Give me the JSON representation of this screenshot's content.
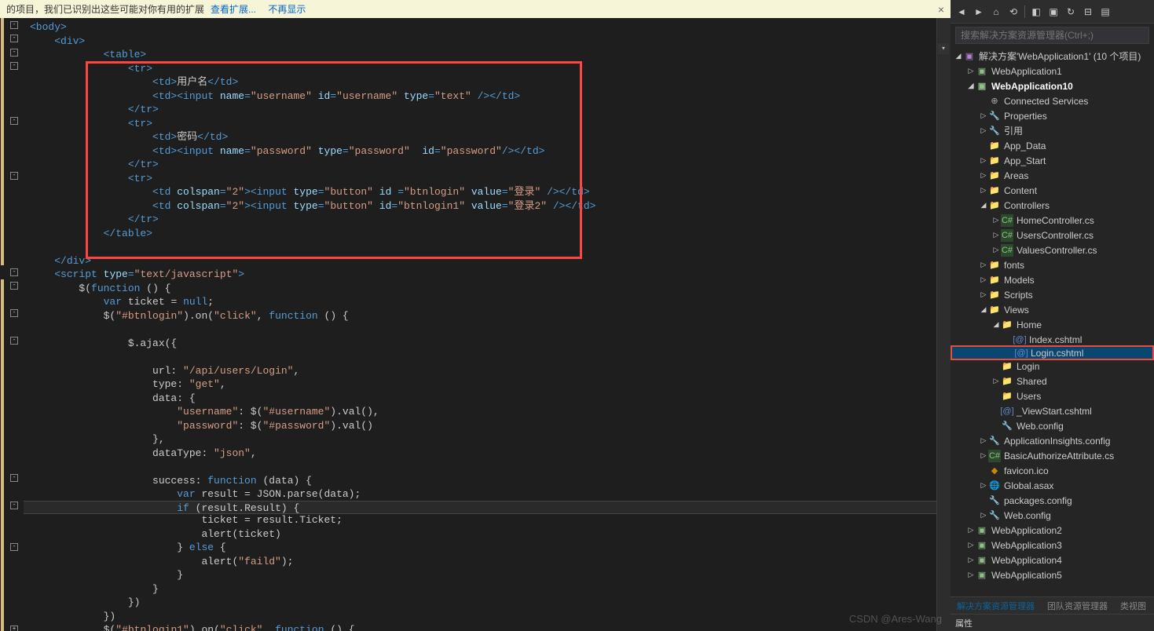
{
  "notification": {
    "text": "的项目，我们已识别出这些可能对你有用的扩展",
    "link1": "查看扩展...",
    "link2": "不再显示"
  },
  "code_lines": [
    {
      "indent": 0,
      "fold": "-",
      "html": "<span class='tag'>&lt;body&gt;</span>"
    },
    {
      "indent": 1,
      "fold": "-",
      "html": "<span class='tag'>&lt;div&gt;</span>"
    },
    {
      "indent": 3,
      "fold": "-",
      "html": "<span class='tag'>&lt;table&gt;</span>"
    },
    {
      "indent": 4,
      "fold": "-",
      "html": "<span class='tag'>&lt;tr&gt;</span>"
    },
    {
      "indent": 5,
      "fold": "",
      "html": "<span class='tag'>&lt;td&gt;</span><span class='txt'>用户名</span><span class='tag'>&lt;/td&gt;</span>"
    },
    {
      "indent": 5,
      "fold": "",
      "html": "<span class='tag'>&lt;td&gt;&lt;input</span> <span class='attr'>name</span><span class='tag'>=</span><span class='str'>\"username\"</span> <span class='attr'>id</span><span class='tag'>=</span><span class='str'>\"username\"</span> <span class='attr'>type</span><span class='tag'>=</span><span class='str'>\"text\"</span> <span class='tag'>/&gt;&lt;/td&gt;</span>"
    },
    {
      "indent": 4,
      "fold": "",
      "html": "<span class='tag'>&lt;/tr&gt;</span>"
    },
    {
      "indent": 4,
      "fold": "-",
      "html": "<span class='tag'>&lt;tr&gt;</span>"
    },
    {
      "indent": 5,
      "fold": "",
      "html": "<span class='tag'>&lt;td&gt;</span><span class='txt'>密码</span><span class='tag'>&lt;/td&gt;</span>"
    },
    {
      "indent": 5,
      "fold": "",
      "html": "<span class='tag'>&lt;td&gt;&lt;input</span> <span class='attr'>name</span><span class='tag'>=</span><span class='str'>\"password\"</span> <span class='attr'>type</span><span class='tag'>=</span><span class='str'>\"password\"</span>  <span class='attr'>id</span><span class='tag'>=</span><span class='str'>\"password\"</span><span class='tag'>/&gt;&lt;/td&gt;</span>"
    },
    {
      "indent": 4,
      "fold": "",
      "html": "<span class='tag'>&lt;/tr&gt;</span>"
    },
    {
      "indent": 4,
      "fold": "-",
      "html": "<span class='tag'>&lt;tr&gt;</span>"
    },
    {
      "indent": 5,
      "fold": "",
      "html": "<span class='tag'>&lt;td</span> <span class='attr'>colspan</span><span class='tag'>=</span><span class='str'>\"2\"</span><span class='tag'>&gt;&lt;input</span> <span class='attr'>type</span><span class='tag'>=</span><span class='str'>\"button\"</span> <span class='attr'>id</span> <span class='tag'>=</span><span class='str'>\"btnlogin\"</span> <span class='attr'>value</span><span class='tag'>=</span><span class='str'>\"登录\"</span> <span class='tag'>/&gt;&lt;/td&gt;</span>"
    },
    {
      "indent": 5,
      "fold": "",
      "html": "<span class='tag'>&lt;td</span> <span class='attr'>colspan</span><span class='tag'>=</span><span class='str'>\"2\"</span><span class='tag'>&gt;&lt;input</span> <span class='attr'>type</span><span class='tag'>=</span><span class='str'>\"button\"</span> <span class='attr'>id</span><span class='tag'>=</span><span class='str'>\"btnlogin1\"</span> <span class='attr'>value</span><span class='tag'>=</span><span class='str'>\"登录2\"</span> <span class='tag'>/&gt;&lt;/td&gt;</span>"
    },
    {
      "indent": 4,
      "fold": "",
      "html": "<span class='tag'>&lt;/tr&gt;</span>"
    },
    {
      "indent": 3,
      "fold": "",
      "html": "<span class='tag'>&lt;/table&gt;</span>"
    },
    {
      "indent": 0,
      "fold": "",
      "html": ""
    },
    {
      "indent": 1,
      "fold": "",
      "html": "<span class='tag'>&lt;/div&gt;</span>"
    },
    {
      "indent": 1,
      "fold": "-",
      "html": "<span class='tag'>&lt;script</span> <span class='attr'>type</span><span class='tag'>=</span><span class='str'>\"text/javascript\"</span><span class='tag'>&gt;</span>"
    },
    {
      "indent": 2,
      "fold": "-",
      "html": "<span class='txt'>$(</span><span class='kw'>function</span> <span class='txt'>() {</span>"
    },
    {
      "indent": 3,
      "fold": "",
      "html": "<span class='kw'>var</span> <span class='txt'>ticket = </span><span class='kw'>null</span><span class='txt'>;</span>"
    },
    {
      "indent": 3,
      "fold": "-",
      "html": "<span class='txt'>$(</span><span class='str'>\"#btnlogin\"</span><span class='txt'>).on(</span><span class='str'>\"click\"</span><span class='txt'>, </span><span class='kw'>function</span> <span class='txt'>() {</span>"
    },
    {
      "indent": 0,
      "fold": "",
      "html": ""
    },
    {
      "indent": 4,
      "fold": "-",
      "html": "<span class='txt'>$.ajax({</span>"
    },
    {
      "indent": 0,
      "fold": "",
      "html": ""
    },
    {
      "indent": 5,
      "fold": "",
      "html": "<span class='txt'>url: </span><span class='str'>\"/api/users/Login\"</span><span class='txt'>,</span>"
    },
    {
      "indent": 5,
      "fold": "",
      "html": "<span class='txt'>type: </span><span class='str'>\"get\"</span><span class='txt'>,</span>"
    },
    {
      "indent": 5,
      "fold": "",
      "html": "<span class='txt'>data: {</span>"
    },
    {
      "indent": 6,
      "fold": "",
      "html": "<span class='str'>\"username\"</span><span class='txt'>: $(</span><span class='str'>\"#username\"</span><span class='txt'>).val(),</span>"
    },
    {
      "indent": 6,
      "fold": "",
      "html": "<span class='str'>\"password\"</span><span class='txt'>: $(</span><span class='str'>\"#password\"</span><span class='txt'>).val()</span>"
    },
    {
      "indent": 5,
      "fold": "",
      "html": "<span class='txt'>},</span>"
    },
    {
      "indent": 5,
      "fold": "",
      "html": "<span class='txt'>dataType: </span><span class='str'>\"json\"</span><span class='txt'>,</span>"
    },
    {
      "indent": 0,
      "fold": "",
      "html": ""
    },
    {
      "indent": 5,
      "fold": "-",
      "html": "<span class='txt'>success: </span><span class='kw'>function</span> <span class='txt'>(data) {</span>"
    },
    {
      "indent": 6,
      "fold": "",
      "html": "<span class='kw'>var</span> <span class='txt'>result = JSON.parse(data);</span>"
    },
    {
      "indent": 6,
      "fold": "-",
      "html": "<span class='kw'>if</span> <span class='txt'>(result.Result) {</span>",
      "current": true
    },
    {
      "indent": 7,
      "fold": "",
      "html": "<span class='txt'>ticket = result.Ticket;</span>"
    },
    {
      "indent": 7,
      "fold": "",
      "html": "<span class='txt'>alert(ticket)</span>"
    },
    {
      "indent": 6,
      "fold": "-",
      "html": "<span class='txt'>} </span><span class='kw'>else</span> <span class='txt'>{</span>"
    },
    {
      "indent": 7,
      "fold": "",
      "html": "<span class='txt'>alert(</span><span class='str'>\"faild\"</span><span class='txt'>);</span>"
    },
    {
      "indent": 6,
      "fold": "",
      "html": "<span class='txt'>}</span>"
    },
    {
      "indent": 5,
      "fold": "",
      "html": "<span class='txt'>}</span>"
    },
    {
      "indent": 4,
      "fold": "",
      "html": "<span class='txt'>})</span>"
    },
    {
      "indent": 3,
      "fold": "",
      "html": "<span class='txt'>})</span>"
    },
    {
      "indent": 3,
      "fold": "+",
      "html": "<span class='txt'>$(</span><span class='str'>\"#btnlogin1\"</span><span class='txt'>).on(</span><span class='str'>\"click\"</span><span class='txt'>, </span><span class='kw'>function</span> <span class='txt'>() {</span>"
    }
  ],
  "explorer": {
    "search_placeholder": "搜索解决方案资源管理器(Ctrl+;)",
    "solution": "解决方案'WebApplication1' (10 个项目)",
    "tree": [
      {
        "depth": 1,
        "arrow": "▷",
        "icon": "proj",
        "label": "WebApplication1"
      },
      {
        "depth": 1,
        "arrow": "◢",
        "icon": "proj",
        "label": "WebApplication10",
        "bold": true
      },
      {
        "depth": 2,
        "arrow": "",
        "icon": "connected",
        "label": "Connected Services"
      },
      {
        "depth": 2,
        "arrow": "▷",
        "icon": "config",
        "label": "Properties"
      },
      {
        "depth": 2,
        "arrow": "▷",
        "icon": "config",
        "label": "引用"
      },
      {
        "depth": 2,
        "arrow": "",
        "icon": "folder",
        "label": "App_Data"
      },
      {
        "depth": 2,
        "arrow": "▷",
        "icon": "folder",
        "label": "App_Start"
      },
      {
        "depth": 2,
        "arrow": "▷",
        "icon": "folder",
        "label": "Areas"
      },
      {
        "depth": 2,
        "arrow": "▷",
        "icon": "folder",
        "label": "Content"
      },
      {
        "depth": 2,
        "arrow": "◢",
        "icon": "folder",
        "label": "Controllers"
      },
      {
        "depth": 3,
        "arrow": "▷",
        "icon": "cs",
        "label": "HomeController.cs"
      },
      {
        "depth": 3,
        "arrow": "▷",
        "icon": "cs",
        "label": "UsersController.cs"
      },
      {
        "depth": 3,
        "arrow": "▷",
        "icon": "cs",
        "label": "ValuesController.cs"
      },
      {
        "depth": 2,
        "arrow": "▷",
        "icon": "folder",
        "label": "fonts"
      },
      {
        "depth": 2,
        "arrow": "▷",
        "icon": "folder",
        "label": "Models"
      },
      {
        "depth": 2,
        "arrow": "▷",
        "icon": "folder",
        "label": "Scripts"
      },
      {
        "depth": 2,
        "arrow": "◢",
        "icon": "folder",
        "label": "Views"
      },
      {
        "depth": 3,
        "arrow": "◢",
        "icon": "folder",
        "label": "Home"
      },
      {
        "depth": 4,
        "arrow": "",
        "icon": "cshtml",
        "label": "Index.cshtml"
      },
      {
        "depth": 4,
        "arrow": "",
        "icon": "cshtml",
        "label": "Login.cshtml",
        "selected": true
      },
      {
        "depth": 3,
        "arrow": "",
        "icon": "folder",
        "label": "Login"
      },
      {
        "depth": 3,
        "arrow": "▷",
        "icon": "folder",
        "label": "Shared"
      },
      {
        "depth": 3,
        "arrow": "",
        "icon": "folder",
        "label": "Users"
      },
      {
        "depth": 3,
        "arrow": "",
        "icon": "cshtml",
        "label": "_ViewStart.cshtml"
      },
      {
        "depth": 3,
        "arrow": "",
        "icon": "config",
        "label": "Web.config"
      },
      {
        "depth": 2,
        "arrow": "▷",
        "icon": "config",
        "label": "ApplicationInsights.config"
      },
      {
        "depth": 2,
        "arrow": "▷",
        "icon": "cs",
        "label": "BasicAuthorizeAttribute.cs"
      },
      {
        "depth": 2,
        "arrow": "",
        "icon": "ico",
        "label": "favicon.ico"
      },
      {
        "depth": 2,
        "arrow": "▷",
        "icon": "global",
        "label": "Global.asax"
      },
      {
        "depth": 2,
        "arrow": "",
        "icon": "config",
        "label": "packages.config"
      },
      {
        "depth": 2,
        "arrow": "▷",
        "icon": "config",
        "label": "Web.config"
      },
      {
        "depth": 1,
        "arrow": "▷",
        "icon": "proj",
        "label": "WebApplication2"
      },
      {
        "depth": 1,
        "arrow": "▷",
        "icon": "proj",
        "label": "WebApplication3"
      },
      {
        "depth": 1,
        "arrow": "▷",
        "icon": "proj",
        "label": "WebApplication4"
      },
      {
        "depth": 1,
        "arrow": "▷",
        "icon": "proj",
        "label": "WebApplication5"
      }
    ]
  },
  "bottom_tabs": {
    "active": "解决方案资源管理器",
    "tab2": "团队资源管理器",
    "tab3": "类视图"
  },
  "properties_label": "属性",
  "watermark": "CSDN @Ares-Wang"
}
